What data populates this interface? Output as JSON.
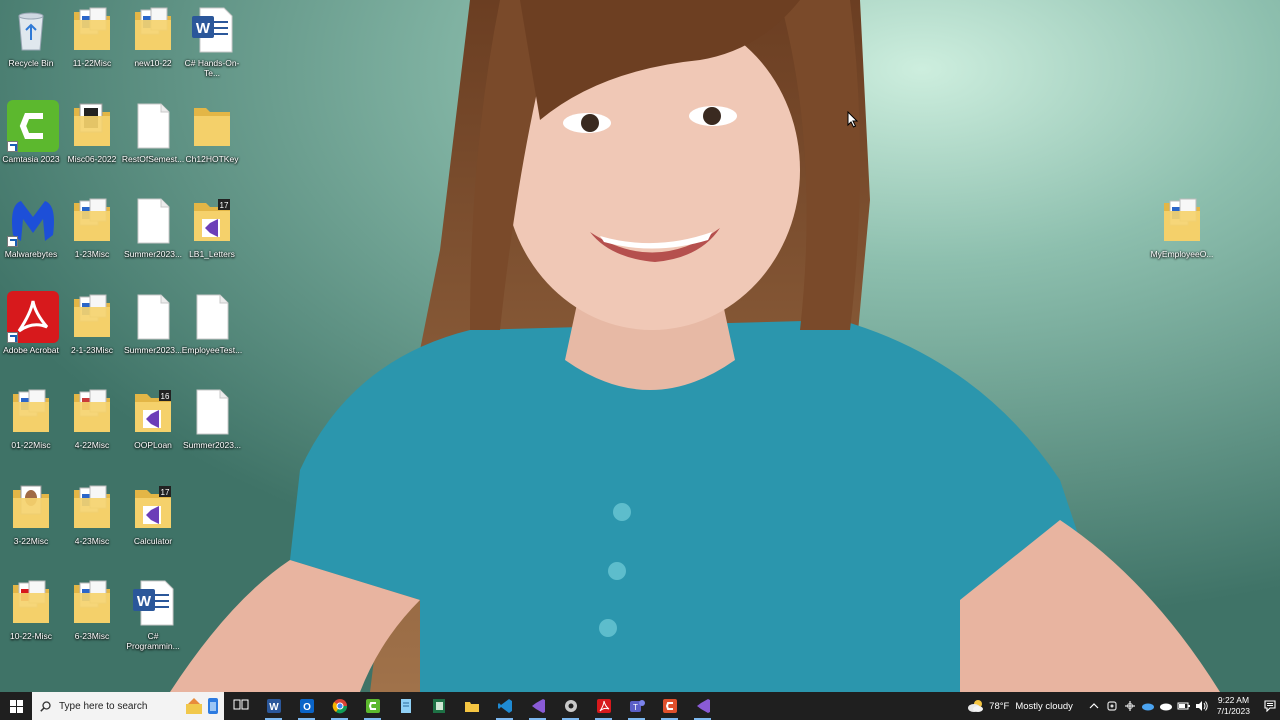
{
  "desktop": {
    "icons": [
      {
        "label": "Recycle Bin",
        "kind": "recycle"
      },
      {
        "label": "11-22Misc",
        "kind": "folder-docs"
      },
      {
        "label": "new10-22",
        "kind": "folder-docs"
      },
      {
        "label": "C# Hands-On-Te...",
        "kind": "word"
      },
      {
        "label": "Camtasia 2023",
        "kind": "camtasia"
      },
      {
        "label": "Misc06-2022",
        "kind": "folder-dark"
      },
      {
        "label": "RestOfSemest...",
        "kind": "blank"
      },
      {
        "label": "Ch12HOTKey",
        "kind": "folder"
      },
      {
        "label": "Malwarebytes",
        "kind": "malwarebytes"
      },
      {
        "label": "1-23Misc",
        "kind": "folder-docs"
      },
      {
        "label": "Summer2023...",
        "kind": "blank"
      },
      {
        "label": "LB1_Letters",
        "kind": "folder-vs17"
      },
      {
        "label": "Adobe Acrobat",
        "kind": "acrobat"
      },
      {
        "label": "2-1-23Misc",
        "kind": "folder-docs"
      },
      {
        "label": "Summer2023...",
        "kind": "blank"
      },
      {
        "label": "EmployeeTest...",
        "kind": "blank"
      },
      {
        "label": "01-22Misc",
        "kind": "folder-docs"
      },
      {
        "label": "4-22Misc",
        "kind": "folder-red"
      },
      {
        "label": "OOPLoan",
        "kind": "folder-vs16"
      },
      {
        "label": "Summer2023...",
        "kind": "blank"
      },
      {
        "label": "3-22Misc",
        "kind": "folder-photo"
      },
      {
        "label": "4-23Misc",
        "kind": "folder-docs"
      },
      {
        "label": "Calculator",
        "kind": "folder-vs17"
      },
      {
        "label": "10-22-Misc",
        "kind": "folder-pdf"
      },
      {
        "label": "6-23Misc",
        "kind": "folder-docs"
      },
      {
        "label": "C# Programmin...",
        "kind": "word"
      },
      {
        "label": "MyEmployeeO...",
        "kind": "folder-docs"
      }
    ]
  },
  "taskbar": {
    "search_placeholder": "Type here to search",
    "apps": [
      "task-view-icon",
      "word-icon",
      "outlook-icon",
      "chrome-icon",
      "camtasia-icon",
      "notepad-icon",
      "excel-icon",
      "file-explorer-icon",
      "vscode-icon",
      "visual-studio-icon",
      "settings-icon",
      "acrobat-icon",
      "teams-icon",
      "camtasia-recorder-icon",
      "visual-studio-2-icon"
    ],
    "weather_temp": "78°F",
    "weather_desc": "Mostly cloudy",
    "time": "9:22 AM",
    "date": "7/1/2023"
  },
  "colors": {
    "taskbar": "#1f1f1f",
    "word": "#2b579a",
    "camtasia": "#5cb82e",
    "acrobat": "#d7191c",
    "malwarebytes": "#1d4fd8",
    "vs": "#6c3eb8",
    "folder": "#f5d36e"
  }
}
